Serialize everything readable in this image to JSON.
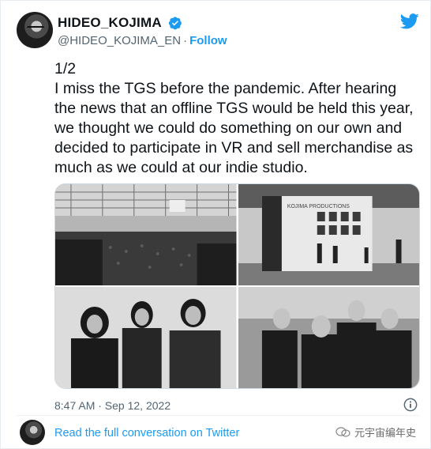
{
  "author": {
    "display_name": "HIDEO_KOJIMA",
    "handle": "@HIDEO_KOJIMA_EN",
    "separator": "·",
    "follow_label": "Follow"
  },
  "tweet": {
    "lines": [
      "1/2",
      "I miss the TGS before the pandemic. After hearing",
      "the news that an offline TGS would be held this year,",
      "we thought we could do something on our own and",
      "decided to participate in VR and sell merchandise as",
      "much as we could at our indie studio."
    ],
    "timestamp": "8:47 AM · Sep 12, 2022",
    "read_more": "Read the full conversation on Twitter"
  },
  "photos": {
    "photo3_sign": "KOJIMA PRODUCTIONS"
  },
  "watermark": "元宇宙编年史",
  "colors": {
    "accent": "#1d9bf0",
    "text": "#0f1419",
    "secondary": "#536471"
  },
  "icons": [
    "verified-badge-icon",
    "twitter-bird-icon",
    "info-icon",
    "wechat-icon"
  ]
}
